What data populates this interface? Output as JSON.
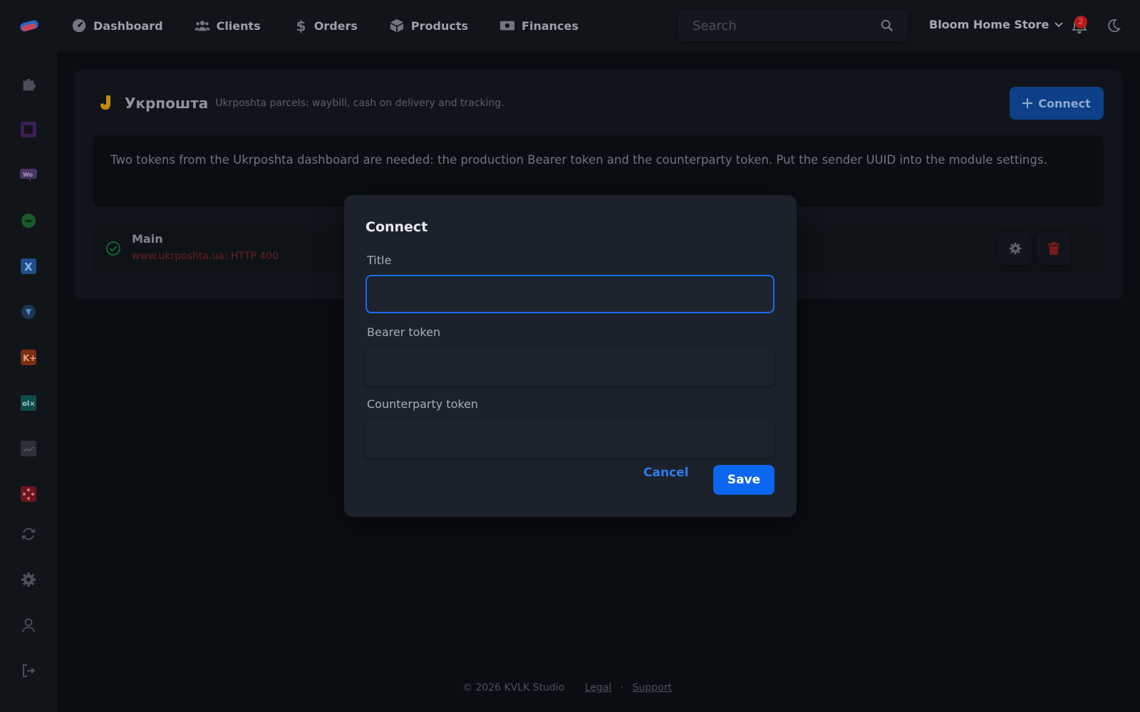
{
  "nav": {
    "items": [
      {
        "label": "Dashboard",
        "icon": "dashboard-icon"
      },
      {
        "label": "Clients",
        "icon": "users-icon"
      },
      {
        "label": "Orders",
        "icon": "dollar-icon"
      },
      {
        "label": "Products",
        "icon": "box-icon"
      },
      {
        "label": "Finances",
        "icon": "money-icon"
      }
    ],
    "search_placeholder": "Search",
    "store_name": "Bloom Home Store",
    "notification_count": "2"
  },
  "sidebar": {
    "items": [
      "puzzle-icon",
      "square-app-icon",
      "woo-icon",
      "smile-app-icon",
      "x-app-icon",
      "shield-app-icon",
      "kplus-app-icon",
      "olx-app-icon",
      "chart-app-icon",
      "network-app-icon",
      "sync-icon",
      "settings-icon",
      "user-icon",
      "logout-icon"
    ]
  },
  "integration": {
    "title": "Укрпошта",
    "subtitle": "Ukrposhta parcels: waybill, cash on delivery and tracking.",
    "connect_label": "Connect",
    "info": "Two tokens from the Ukrposhta dashboard are needed: the production Bearer token and the counterparty token. Put the sender UUID into the module settings.",
    "connection": {
      "name": "Main",
      "error": "www.ukrposhta.ua: HTTP 400"
    }
  },
  "modal": {
    "title": "Connect",
    "fields": [
      {
        "label": "Title",
        "value": ""
      },
      {
        "label": "Bearer token",
        "value": ""
      },
      {
        "label": "Counterparty token",
        "value": ""
      }
    ],
    "cancel_label": "Cancel",
    "save_label": "Save"
  },
  "footer": {
    "copyright": "© 2026 KVLK Studio",
    "legal": "Legal",
    "separator": "·",
    "support": "Support"
  },
  "colors": {
    "accent": "#0d66ef",
    "error": "#6a1f1f",
    "success": "#1f9d55",
    "brand_ukrposhta": "#e0a411"
  }
}
